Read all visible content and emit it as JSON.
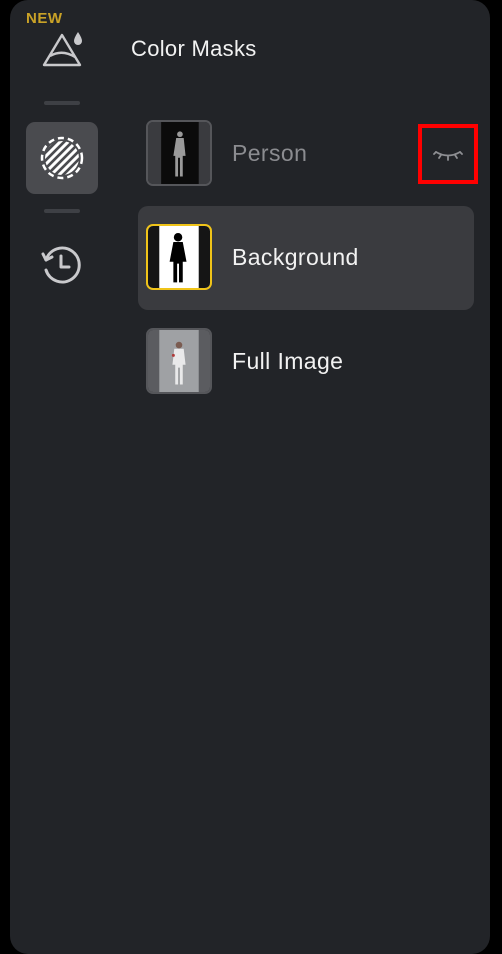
{
  "header": {
    "badge": "NEW",
    "title": "Color Masks"
  },
  "masks": [
    {
      "label": "Person",
      "visible": false,
      "selected": false
    },
    {
      "label": "Background",
      "visible": true,
      "selected": true
    },
    {
      "label": "Full Image",
      "visible": true,
      "selected": false
    }
  ],
  "icons": {
    "mask_tool": "mountain-drop-icon",
    "masks_tab": "hatched-circle-icon",
    "history": "history-icon",
    "visibility": "eye-closed-icon"
  },
  "colors": {
    "panel": "#222428",
    "accent": "#f0c419",
    "badge": "#c9a227",
    "highlight": "#ff0000"
  }
}
